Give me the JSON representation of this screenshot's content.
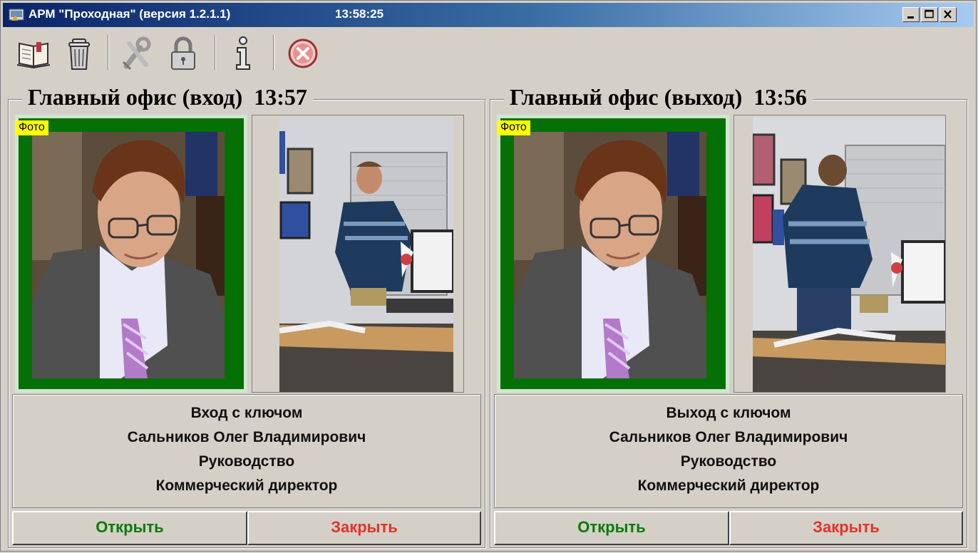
{
  "window": {
    "title": "АРМ \"Проходная\" (версия 1.2.1.1)",
    "clock": "13:58:25"
  },
  "toolbar": {
    "icons": [
      "book-icon",
      "trash-icon",
      "tools-icon",
      "lock-icon",
      "info-icon",
      "stop-icon"
    ]
  },
  "panels": [
    {
      "header": "Главный офис (вход)  13:57",
      "photo_label": "Фото",
      "info": [
        "Вход с ключом",
        "Сальников Олег Владимирович",
        "Руководство",
        "Коммерческий директор"
      ],
      "open_label": "Открыть",
      "close_label": "Закрыть"
    },
    {
      "header": "Главный офис (выход)  13:56",
      "photo_label": "Фото",
      "info": [
        "Выход с ключом",
        "Сальников Олег Владимирович",
        "Руководство",
        "Коммерческий директор"
      ],
      "open_label": "Открыть",
      "close_label": "Закрыть"
    }
  ],
  "colors": {
    "photo_frame": "#057005",
    "open_text": "#0a7a0a",
    "close_text": "#e63228",
    "photo_tag": "#ffff00"
  }
}
